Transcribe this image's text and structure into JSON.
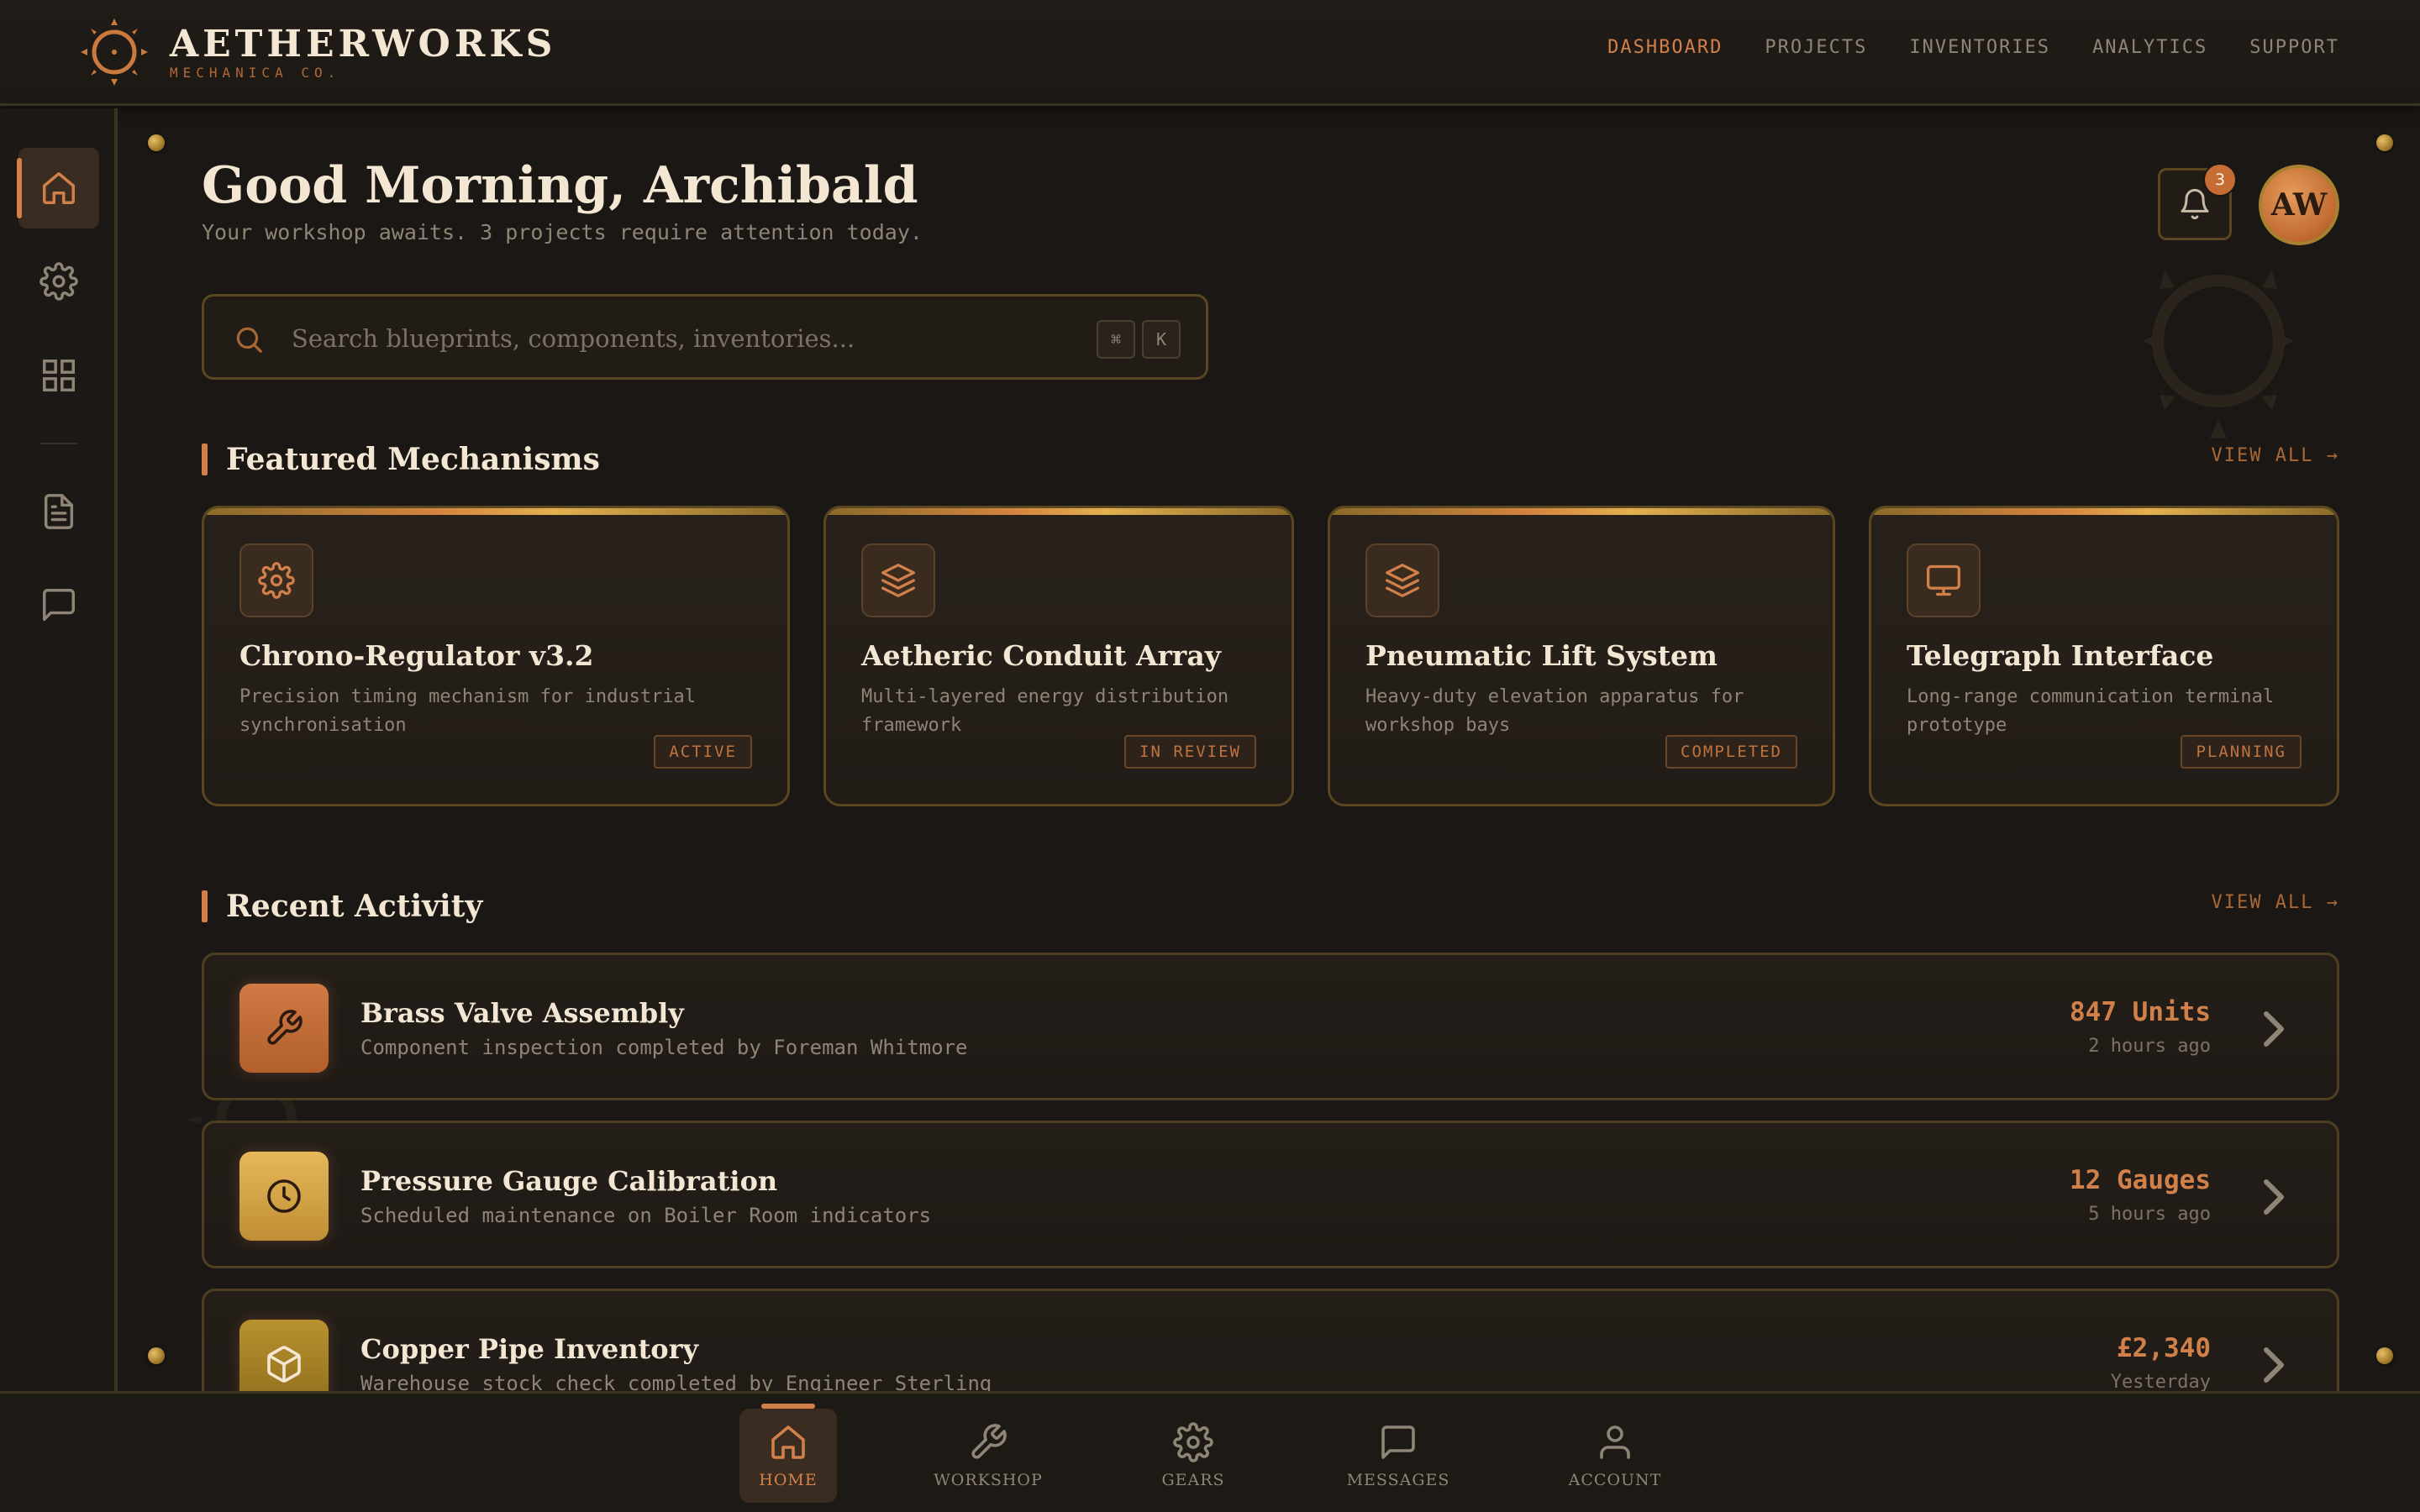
{
  "brand": {
    "title": "AETHERWORKS",
    "subtitle": "MECHANICA CO."
  },
  "topnav": [
    {
      "label": "DASHBOARD",
      "active": true
    },
    {
      "label": "PROJECTS",
      "active": false
    },
    {
      "label": "INVENTORIES",
      "active": false
    },
    {
      "label": "ANALYTICS",
      "active": false
    },
    {
      "label": "SUPPORT",
      "active": false
    }
  ],
  "rail": [
    {
      "icon": "home-icon",
      "active": true
    },
    {
      "icon": "gear-icon",
      "active": false
    },
    {
      "icon": "grid-icon",
      "active": false
    },
    {
      "icon": "document-icon",
      "active": false
    },
    {
      "icon": "message-icon",
      "active": false
    }
  ],
  "header": {
    "greeting": "Good Morning, Archibald",
    "subtitle": "Your workshop awaits. 3 projects require attention today.",
    "notification_count": "3",
    "avatar_initials": "AW"
  },
  "search": {
    "placeholder": "Search blueprints, components, inventories...",
    "value": "",
    "shortcut_keys": [
      "⌘",
      "K"
    ]
  },
  "featured": {
    "title": "Featured Mechanisms",
    "view_all": "VIEW ALL →",
    "cards": [
      {
        "icon": "gear-icon",
        "title": "Chrono-Regulator v3.2",
        "description": "Precision timing mechanism for industrial synchronisation",
        "status": "ACTIVE"
      },
      {
        "icon": "layers-icon",
        "title": "Aetheric Conduit Array",
        "description": "Multi-layered energy distribution framework",
        "status": "IN REVIEW"
      },
      {
        "icon": "layers-icon",
        "title": "Pneumatic Lift System",
        "description": "Heavy-duty elevation apparatus for workshop bays",
        "status": "COMPLETED"
      },
      {
        "icon": "monitor-icon",
        "title": "Telegraph Interface",
        "description": "Long-range communication terminal prototype",
        "status": "PLANNING"
      }
    ]
  },
  "activity": {
    "title": "Recent Activity",
    "view_all": "VIEW ALL →",
    "items": [
      {
        "icon": "wrench-icon",
        "title": "Brass Valve Assembly",
        "description": "Component inspection completed by Foreman Whitmore",
        "value": "847 Units",
        "time": "2 hours ago"
      },
      {
        "icon": "clock-icon",
        "title": "Pressure Gauge Calibration",
        "description": "Scheduled maintenance on Boiler Room indicators",
        "value": "12 Gauges",
        "time": "5 hours ago"
      },
      {
        "icon": "box-icon",
        "title": "Copper Pipe Inventory",
        "description": "Warehouse stock check completed by Engineer Sterling",
        "value": "£2,340",
        "time": "Yesterday"
      }
    ]
  },
  "bottomnav": [
    {
      "icon": "home-icon",
      "label": "HOME",
      "active": true
    },
    {
      "icon": "wrench-icon",
      "label": "WORKSHOP",
      "active": false
    },
    {
      "icon": "gear-icon",
      "label": "GEARS",
      "active": false
    },
    {
      "icon": "message-icon",
      "label": "MESSAGES",
      "active": false
    },
    {
      "icon": "user-icon",
      "label": "ACCOUNT",
      "active": false
    }
  ],
  "colors": {
    "accent": "#d2804a",
    "brass": "#5a4722",
    "background": "#1b1714",
    "text": "#f3e7d3",
    "muted": "#8f8577"
  }
}
